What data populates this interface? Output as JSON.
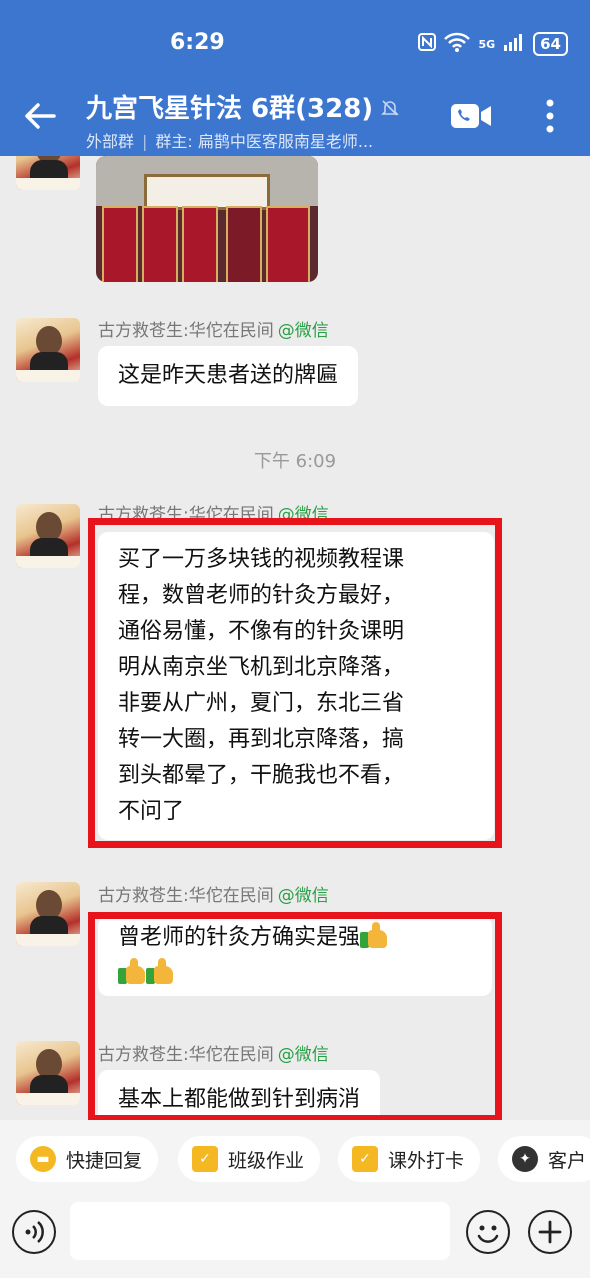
{
  "status_bar": {
    "time": "6:29",
    "network": "5G",
    "battery": "64"
  },
  "header": {
    "title": "九宫飞星针法 6群(328)",
    "group_type": "外部群",
    "owner": "群主: 扁鹊中医客服南星老师..."
  },
  "messages": [
    {
      "sender": "古方救苍生:华佗在民间",
      "source_tag": "@微信",
      "text": "这是昨天患者送的牌匾"
    },
    {
      "sender": "古方救苍生:华佗在民间",
      "source_tag": "@微信",
      "lines": [
        "买了一万多块钱的视频教程课",
        "程，数曾老师的针灸方最好，",
        "通俗易懂，不像有的针灸课明",
        "明从南京坐飞机到北京降落，",
        "非要从广州，夏门，东北三省",
        "转一大圈，再到北京降落，搞",
        "到头都晕了，干脆我也不看，",
        "不问了"
      ]
    },
    {
      "sender": "古方救苍生:华佗在民间",
      "source_tag": "@微信",
      "text": "曾老师的针灸方确实是强"
    },
    {
      "sender": "古方救苍生:华佗在民间",
      "source_tag": "@微信",
      "text": "基本上都能做到针到病消"
    }
  ],
  "timestamp": "下午 6:09",
  "quick_replies": [
    "快捷回复",
    "班级作业",
    "课外打卡",
    "客户"
  ],
  "icons": {
    "back": "back-arrow-icon",
    "mute": "mute-bell-icon",
    "video": "video-call-icon",
    "more": "more-vertical-icon",
    "voice": "voice-input-icon",
    "emoji": "emoji-icon",
    "plus": "plus-icon",
    "thumbs": "thumbs-up-emoji-icon"
  },
  "colors": {
    "header": "#3d76cf",
    "highlight": "#e8141c",
    "wechat_tag": "#2aa046",
    "quick_reply_icon": "#f4b922"
  }
}
